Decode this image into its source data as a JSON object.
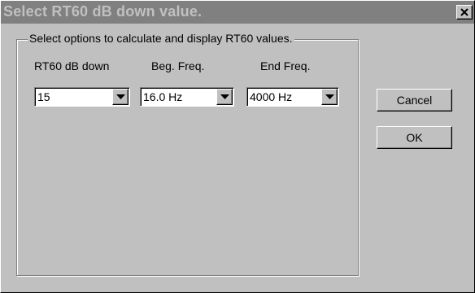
{
  "window": {
    "title": "Select RT60 dB down value."
  },
  "group": {
    "legend": "Select options to calculate and display RT60 values."
  },
  "fields": {
    "db_down": {
      "label": "RT60 dB down",
      "value": "15"
    },
    "beg_freq": {
      "label": "Beg. Freq.",
      "value": "16.0 Hz"
    },
    "end_freq": {
      "label": "End Freq.",
      "value": "4000 Hz"
    }
  },
  "buttons": {
    "cancel": "Cancel",
    "ok": "OK"
  },
  "icons": {
    "close": "close-icon",
    "dropdown": "chevron-down-icon"
  },
  "colors": {
    "face": "#c0c0c0",
    "titlebar": "#808080",
    "title_text": "#c0c0c0"
  }
}
